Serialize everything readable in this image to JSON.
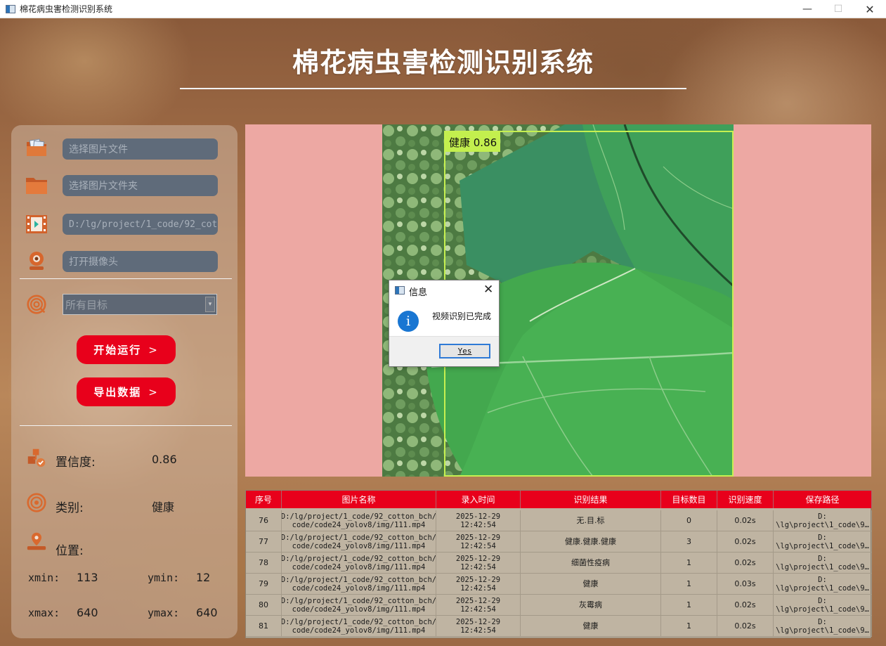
{
  "window": {
    "title": "棉花病虫害检测识别系统",
    "minimize": "—",
    "maximize": "☐",
    "close": "✕"
  },
  "header": {
    "title": "棉花病虫害检测识别系统"
  },
  "sources": {
    "image_file": "选择图片文件",
    "image_folder": "选择图片文件夹",
    "video_path": "D:/lg/project/1_code/92_cot",
    "camera": "打开摄像头"
  },
  "target_select": {
    "value": "所有目标",
    "arrow": "▾"
  },
  "buttons": {
    "start": "开始运行",
    "export": "导出数据",
    "chevron": ">"
  },
  "details": {
    "confidence_label": "置信度:",
    "confidence_value": "0.86",
    "category_label": "类别:",
    "category_value": "健康",
    "position_label": "位置:",
    "xmin_label": "xmin:",
    "xmin_value": "113",
    "ymin_label": "ymin:",
    "ymin_value": "12",
    "xmax_label": "xmax:",
    "xmax_value": "640",
    "ymax_label": "ymax:",
    "ymax_value": "640"
  },
  "detection": {
    "label": "健康 0.86"
  },
  "dialog": {
    "title": "信息",
    "message": "视频识别已完成",
    "yes": "Yes",
    "close": "✕",
    "info_glyph": "i"
  },
  "table": {
    "headers": [
      "序号",
      "图片名称",
      "录入时间",
      "识别结果",
      "目标数目",
      "识别速度",
      "保存路径"
    ],
    "rows": [
      [
        "76",
        "D:/lg/project/1_code/92_cotton_bch/\ncode/code24_yolov8/img/111.mp4",
        "2025-12-29\n12:42:54",
        "无.目.标",
        "0",
        "0.02s",
        "D:\n\\lg\\project\\1_code\\9…"
      ],
      [
        "77",
        "D:/lg/project/1_code/92_cotton_bch/\ncode/code24_yolov8/img/111.mp4",
        "2025-12-29\n12:42:54",
        "健康.健康.健康",
        "3",
        "0.02s",
        "D:\n\\lg\\project\\1_code\\9…"
      ],
      [
        "78",
        "D:/lg/project/1_code/92_cotton_bch/\ncode/code24_yolov8/img/111.mp4",
        "2025-12-29\n12:42:54",
        "细菌性疫病",
        "1",
        "0.02s",
        "D:\n\\lg\\project\\1_code\\9…"
      ],
      [
        "79",
        "D:/lg/project/1_code/92_cotton_bch/\ncode/code24_yolov8/img/111.mp4",
        "2025-12-29\n12:42:54",
        "健康",
        "1",
        "0.03s",
        "D:\n\\lg\\project\\1_code\\9…"
      ],
      [
        "80",
        "D:/lg/project/1_code/92_cotton_bch/\ncode/code24_yolov8/img/111.mp4",
        "2025-12-29\n12:42:54",
        "灰霉病",
        "1",
        "0.02s",
        "D:\n\\lg\\project\\1_code\\9…"
      ],
      [
        "81",
        "D:/lg/project/1_code/92_cotton_bch/\ncode/code24_yolov8/img/111.mp4",
        "2025-12-29\n12:42:54",
        "健康",
        "1",
        "0.02s",
        "D:\n\\lg\\project\\1_code\\9…"
      ]
    ]
  },
  "colors": {
    "accent_red": "#e8001b",
    "display_bg": "#eda8a3",
    "box_green": "#c6f051",
    "field_bg": "#5f6b7a",
    "icon_orange": "#d9692e"
  },
  "icons": [
    "image-file-icon",
    "folder-icon",
    "video-icon",
    "camera-icon",
    "target-icon",
    "confidence-icon",
    "category-icon",
    "location-icon",
    "info-icon"
  ]
}
